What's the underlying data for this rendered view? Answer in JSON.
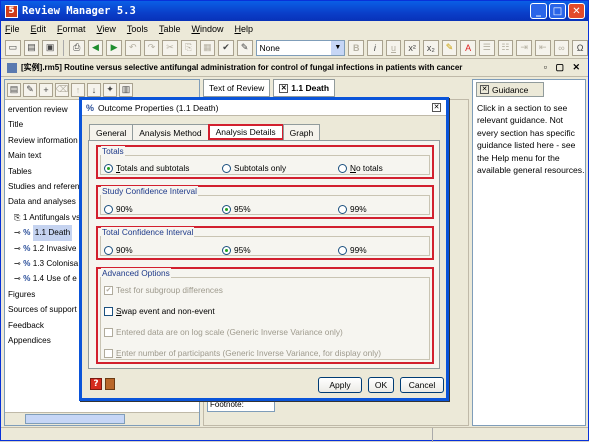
{
  "app": {
    "title": "Review Manager 5.3"
  },
  "menu": [
    "File",
    "Edit",
    "Format",
    "View",
    "Tools",
    "Table",
    "Window",
    "Help"
  ],
  "toolbar": {
    "style_value": "None",
    "format_buttons": [
      "B",
      "i",
      "u",
      "x²",
      "x₂"
    ],
    "icons": [
      "new-icon",
      "open-icon",
      "save-icon",
      "print-icon",
      "back-icon",
      "forward-icon",
      "undo-icon",
      "redo-icon",
      "cut-icon",
      "copy-icon",
      "paste-icon",
      "spellcheck-icon",
      "thesaurus-icon",
      "omega-icon"
    ]
  },
  "document": {
    "title": "[实例].rm5] Routine versus selective antifungal administration for control of fungal infections in patients with cancer"
  },
  "tree": {
    "items": [
      "ervention review",
      "Title",
      "Review information",
      "Main text",
      "Tables",
      "Studies and referen",
      "Data and analyses",
      "1 Antifungals vs",
      "1.1 Death",
      "1.2 Invasive",
      "1.3 Colonisa",
      "1.4 Use of e",
      "Figures",
      "Sources of support",
      "Feedback",
      "Appendices"
    ],
    "selected": "1.1 Death"
  },
  "tabs": {
    "text_of_review": "Text of Review",
    "death": "1.1 Death"
  },
  "footnote_label": "Footnote:",
  "guidance": {
    "tab": "Guidance",
    "text": "Click in a section to see relevant guidance. Not every section has specific guidance listed here - see the Help menu for the available general resources."
  },
  "dialog": {
    "title": "Outcome Properties (1.1 Death)",
    "tabs": [
      "General",
      "Analysis Method",
      "Analysis Details",
      "Graph"
    ],
    "active_tab": "Analysis Details",
    "totals": {
      "legend": "Totals",
      "options": [
        "Totals and subtotals",
        "Subtotals only",
        "No totals"
      ],
      "selected": "Totals and subtotals"
    },
    "study_ci": {
      "legend": "Study Confidence Interval",
      "options": [
        "90%",
        "95%",
        "99%"
      ],
      "selected": "95%"
    },
    "total_ci": {
      "legend": "Total Confidence Interval",
      "options": [
        "90%",
        "95%",
        "99%"
      ],
      "selected": "95%"
    },
    "advanced": {
      "legend": "Advanced Options",
      "test_subgroup": "Test for subgroup differences",
      "swap_event": "Swap event and non-event",
      "log_scale": "Entered data are on log scale (Generic Inverse Variance only)",
      "enter_participants": "Enter number of participants (Generic Inverse Variance, for display only)"
    },
    "buttons": {
      "apply": "Apply",
      "ok": "OK",
      "cancel": "Cancel"
    }
  }
}
